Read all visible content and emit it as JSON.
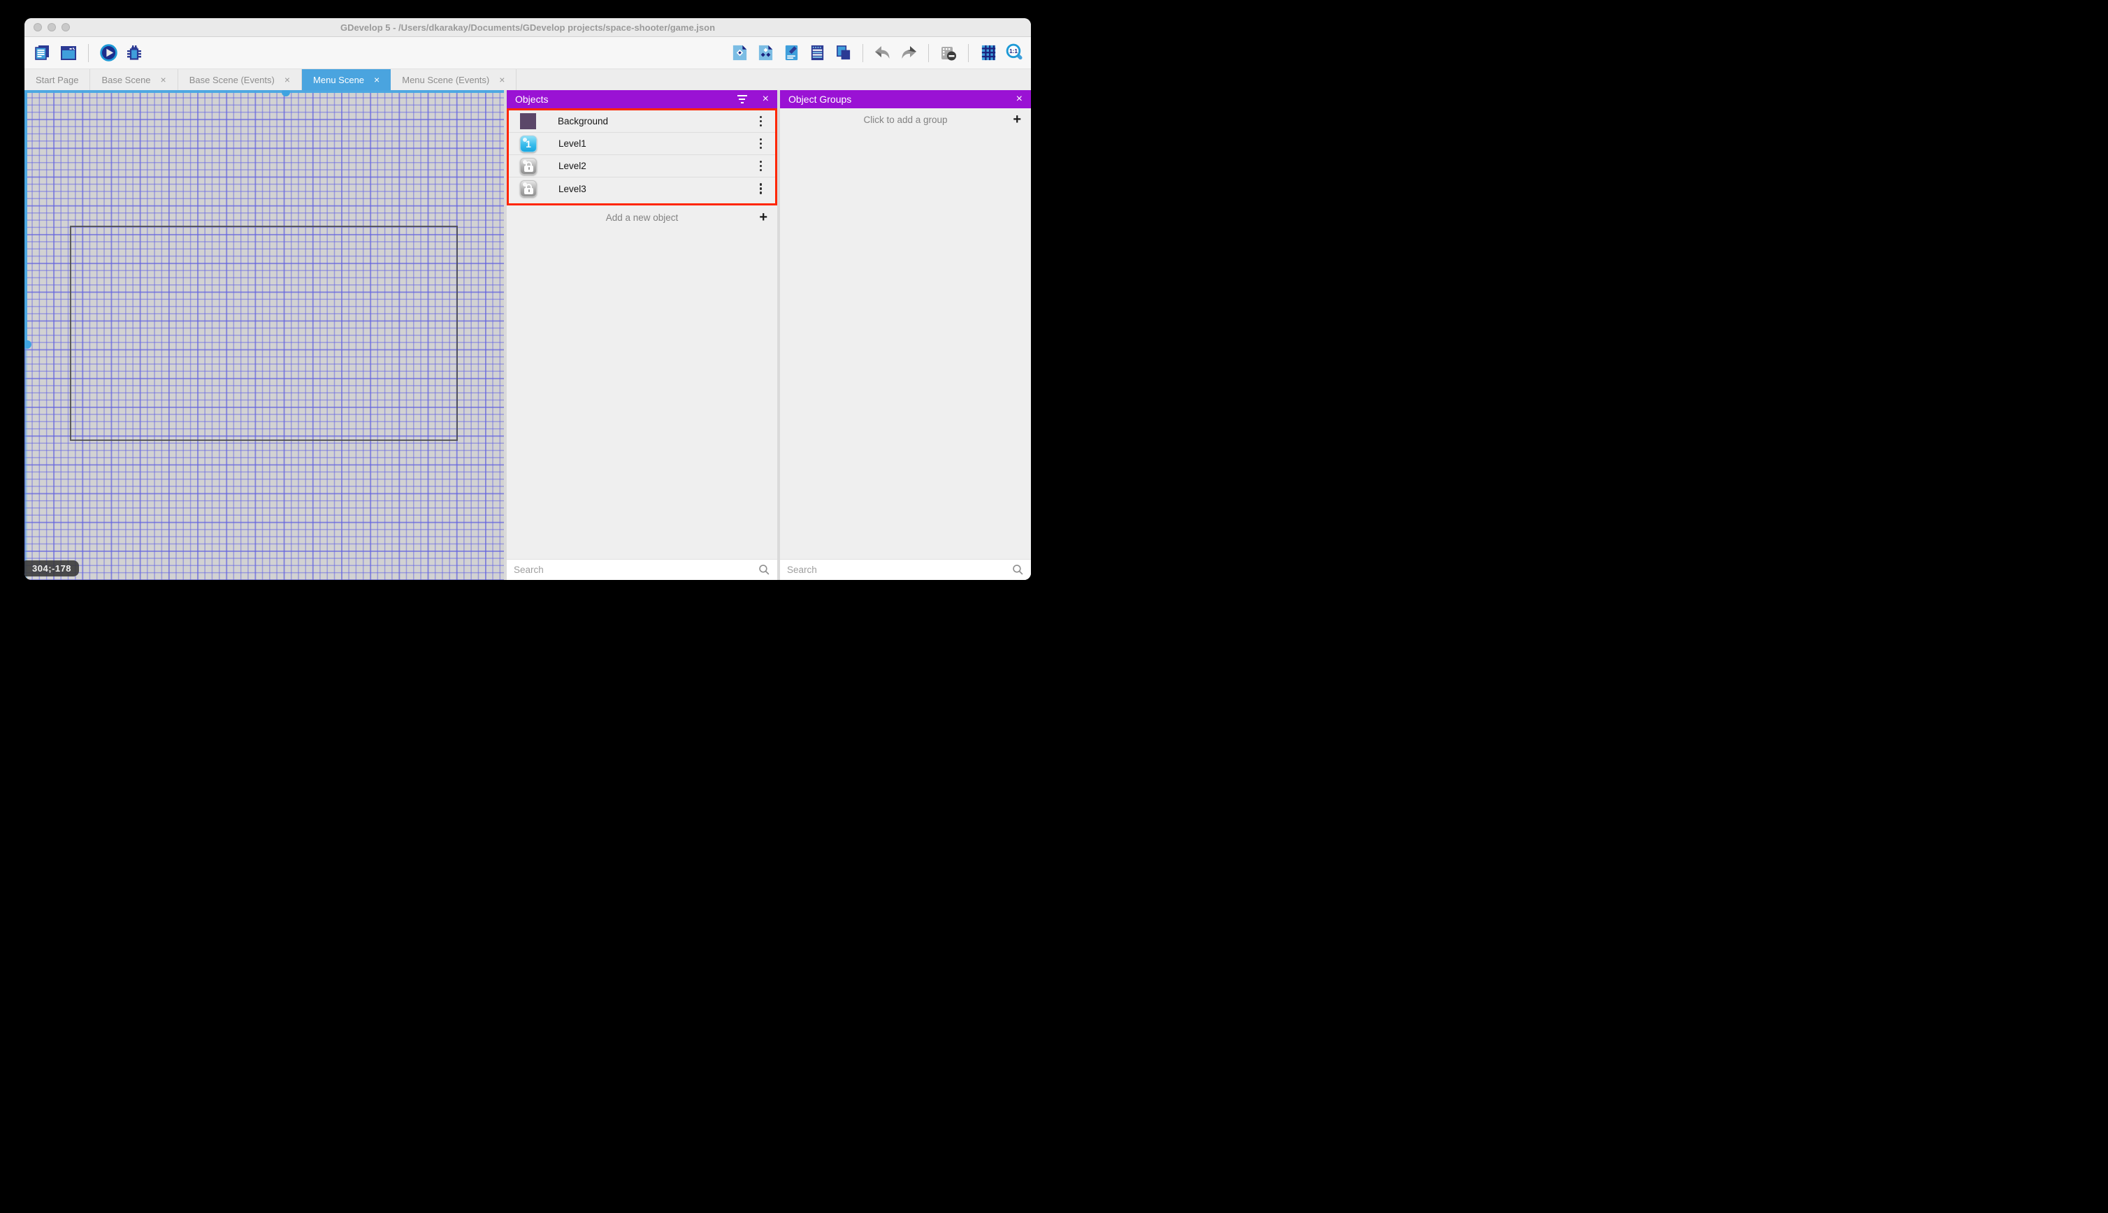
{
  "window": {
    "title": "GDevelop 5 - /Users/dkarakay/Documents/GDevelop projects/space-shooter/game.json"
  },
  "toolbar": {
    "left_icons": [
      "project-manager-icon",
      "scene-window-icon",
      "preview-play-icon",
      "debug-icon"
    ],
    "right_icons": [
      "objects-editor-icon",
      "object-groups-editor-icon",
      "properties-icon",
      "instances-list-icon",
      "layers-icon",
      "undo-icon",
      "redo-icon",
      "window-mask-icon",
      "grid-icon",
      "zoom-1-1-icon"
    ]
  },
  "tabs": {
    "close_glyph": "×",
    "items": [
      {
        "label": "Start Page",
        "closable": false,
        "active": false
      },
      {
        "label": "Base Scene",
        "closable": true,
        "active": false
      },
      {
        "label": "Base Scene (Events)",
        "closable": true,
        "active": false
      },
      {
        "label": "Menu Scene",
        "closable": true,
        "active": true
      },
      {
        "label": "Menu Scene (Events)",
        "closable": true,
        "active": false
      }
    ]
  },
  "canvas": {
    "coordinate_badge": "304;-178"
  },
  "objects_panel": {
    "title": "Objects",
    "close_glyph": "×",
    "objects": [
      {
        "name": "Background",
        "icon": "purple-square-thumbnail",
        "badge": ""
      },
      {
        "name": "Level1",
        "icon": "level-one-thumbnail",
        "badge": "1"
      },
      {
        "name": "Level2",
        "icon": "locked-thumbnail",
        "badge": ""
      },
      {
        "name": "Level3",
        "icon": "locked-thumbnail",
        "badge": ""
      }
    ],
    "add_button": "Add a new object",
    "add_glyph": "+",
    "search_placeholder": "Search"
  },
  "object_groups_panel": {
    "title": "Object Groups",
    "close_glyph": "×",
    "add_button": "Click to add a group",
    "add_glyph": "+",
    "search_placeholder": "Search"
  },
  "colors": {
    "panel_header_purple": "#9A12D4",
    "active_tab_blue": "#4AA4DF",
    "selection_highlight_red": "#FF2600",
    "scrollbar_blue": "#49A8E1",
    "canvas_grid_line": "#6363E4",
    "background_thumbnail_purple": "#5B4769"
  }
}
